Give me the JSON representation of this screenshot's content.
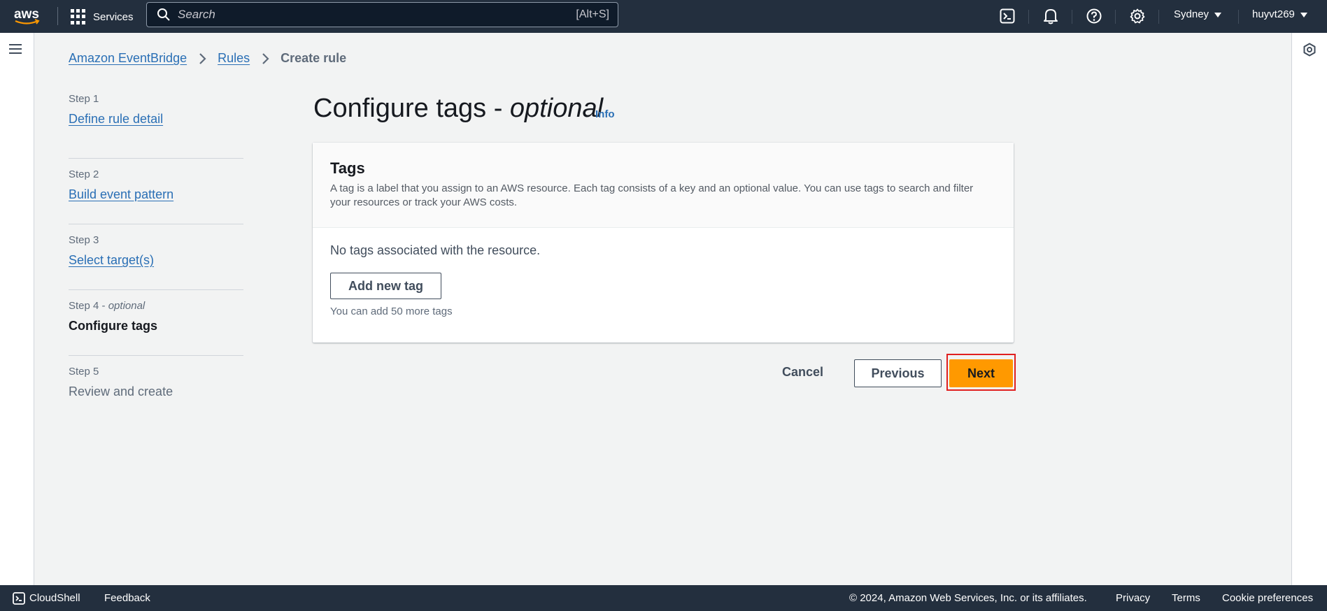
{
  "topnav": {
    "logo_text": "aws",
    "services_label": "Services",
    "search_placeholder": "Search",
    "search_shortcut": "[Alt+S]",
    "region": "Sydney",
    "user": "huyvt269"
  },
  "breadcrumb": {
    "items": [
      "Amazon EventBridge",
      "Rules"
    ],
    "current": "Create rule"
  },
  "steps": [
    {
      "label": "Step 1",
      "title": "Define rule detail"
    },
    {
      "label": "Step 2",
      "title": "Build event pattern"
    },
    {
      "label": "Step 3",
      "title": "Select target(s)"
    },
    {
      "label": "Step 4",
      "label_suffix": "optional",
      "title": "Configure tags"
    },
    {
      "label": "Step 5",
      "title": "Review and create"
    }
  ],
  "main": {
    "title": "Configure tags - ",
    "title_optional": "optional",
    "info_link": "Info",
    "card": {
      "title": "Tags",
      "description": "A tag is a label that you assign to an AWS resource. Each tag consists of a key and an optional value. You can use tags to search and filter your resources or track your AWS costs.",
      "empty_text": "No tags associated with the resource.",
      "add_button": "Add new tag",
      "hint": "You can add 50 more tags"
    },
    "actions": {
      "cancel": "Cancel",
      "previous": "Previous",
      "next": "Next"
    }
  },
  "footer": {
    "cloudshell": "CloudShell",
    "feedback": "Feedback",
    "copyright": "© 2024, Amazon Web Services, Inc. or its affiliates.",
    "privacy": "Privacy",
    "terms": "Terms",
    "cookies": "Cookie preferences"
  },
  "colors": {
    "nav_bg": "#232f3e",
    "accent": "#ff9900",
    "link": "#2a6fb5",
    "highlight": "#e02020"
  }
}
